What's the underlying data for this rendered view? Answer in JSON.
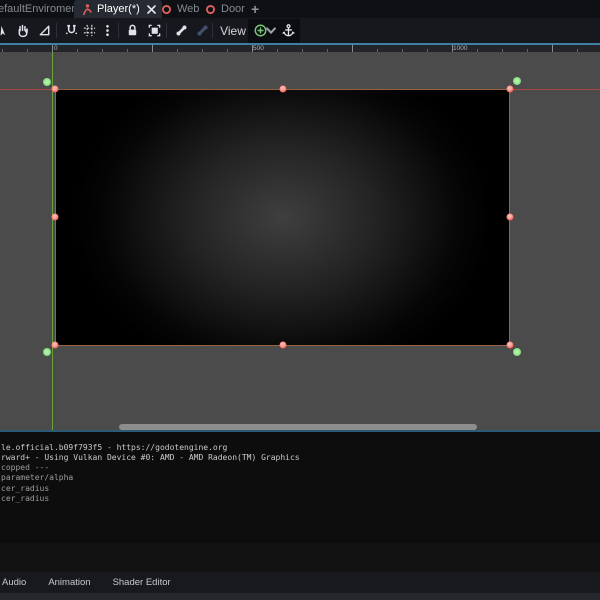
{
  "scene_tabs": {
    "tab_default_env": "efaultEnviroment",
    "tab_player": "Player(*)",
    "tab_web": "Web",
    "tab_door": "Door",
    "new_tab_label": "+"
  },
  "toolbar": {
    "view_menu_label": "View",
    "icon_names": [
      "list-select-mode-icon",
      "pan-mode-icon",
      "ruler-mode-icon",
      "smart-snap-icon",
      "grid-snap-icon",
      "snap-options-icon",
      "lock-icon",
      "group-icon",
      "bone-icon",
      "skeleton-options-icon",
      "anchors-preset-icon",
      "chevron-down-icon",
      "anchor-icon"
    ]
  },
  "ruler": {
    "label_0": "0",
    "label_500": "500",
    "label_1000": "1000"
  },
  "output_log": {
    "lines": [
      "le.official.b09f793f5 - https://godotengine.org",
      "rward+ - Using Vulkan Device #0: AMD - AMD Radeon(TM) Graphics",
      "",
      "copped ---",
      "parameter/alpha",
      "cer_radius",
      "cer_radius"
    ]
  },
  "bottom_bar": {
    "audio": "Audio",
    "animation": "Animation",
    "shader_editor": "Shader Editor"
  },
  "colors": {
    "focus_border_blue": "#3f7fa3",
    "selection_border": "#9a6140",
    "handle_red": "#ef5a50",
    "anchor_green": "#7fd878",
    "axis_x_red": "#a84a44",
    "axis_y_green": "#6aa33e",
    "scene_icon_red": "#e25f5b",
    "anchors_icon_green": "#7ac77a"
  }
}
